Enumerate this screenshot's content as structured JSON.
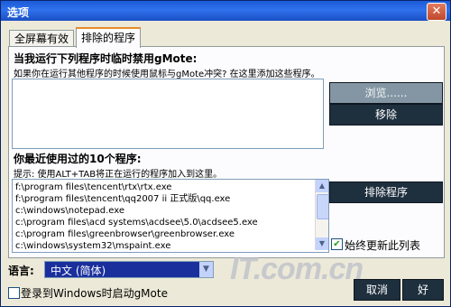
{
  "window": {
    "title": "选项",
    "close_glyph": "✕"
  },
  "tabs": [
    {
      "label": "全屏幕有效",
      "active": false
    },
    {
      "label": "排除的程序",
      "active": true
    }
  ],
  "exclusions": {
    "heading": "当我运行下列程序时临时禁用gMote:",
    "hint": "如果你在运行其他程序的时候使用鼠标与gMote冲突? 在这里添加这些程序。",
    "browse_label": "浏览......",
    "remove_label": "移除"
  },
  "recent": {
    "heading": "你最近使用过的10个程序:",
    "hint": "提示: 使用ALT+TAB将正在运行的程序加入到这里。",
    "items": [
      "f:\\program files\\tencent\\rtx\\rtx.exe",
      "f:\\program files\\tencent\\qq2007 ii 正式版\\qq.exe",
      "c:\\windows\\notepad.exe",
      "c:\\program files\\acd systems\\acdsee\\5.0\\acdsee5.exe",
      "c:\\program files\\greenbrowser\\greenbrowser.exe",
      "c:\\windows\\system32\\mspaint.exe"
    ],
    "exclude_label": "排除程序",
    "always_update_label": "始终更新此列表",
    "always_update_checked": true
  },
  "language": {
    "label": "语言:",
    "selected": "中文 (简体)"
  },
  "startup": {
    "label": "登录到Windows时启动gMote",
    "checked": false
  },
  "footer": {
    "cancel_label": "取消",
    "ok_label": "好"
  },
  "watermark": "IT.com.cn",
  "colors": {
    "titlebar": "#2f71ec",
    "dark_button": "#1e2f3e",
    "select_bg": "#1a2f9c"
  }
}
